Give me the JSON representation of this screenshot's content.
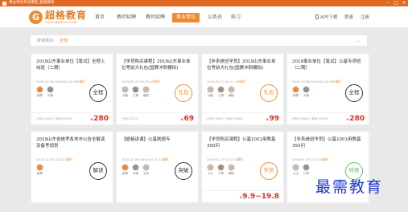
{
  "window": {
    "title": "事业单位考试课程_超格教育"
  },
  "logo": {
    "name": "超格教育",
    "sub": "CHAOGEJIAOYU.COM",
    "mark": "G"
  },
  "nav": {
    "items": [
      "首页",
      "教师招聘",
      "教师招聘",
      "事业单位",
      "公务员",
      "练习"
    ],
    "active_index": 3,
    "app_download": "APP下载",
    "login": "登录",
    "register": "注册"
  },
  "filter": {
    "label": "按课类别：",
    "value": "全部"
  },
  "cards": [
    {
      "title": "2019山东事业单位【笔试】全程上岗班（二期）",
      "meta": "2018.10.08-2019.02.24",
      "hours": "399课时",
      "teachers": [
        "超哥",
        "刘涛"
      ],
      "stamp": "全程",
      "stamp_style": "dark",
      "footer": "已购(24456) | 剩余(33500)",
      "price": "280"
    },
    {
      "title": "【学员购买课程】2019山东事业单位考前大礼包(国赛冲刺模拟)",
      "meta": "2019.02.27-03.12",
      "hours": "45课时",
      "teachers": [
        "问鼎",
        "江哥",
        "朝阳"
      ],
      "stamp": "礼包",
      "stamp_style": "orange",
      "footer": "已购(14125)",
      "price": "69"
    },
    {
      "title": "【非系统班学员】2019山东事业单位考前大礼包(国赛冲刺模拟)",
      "meta": "2019.02.27-03.11",
      "hours": "45课时",
      "teachers": [
        "问鼎",
        "江哥",
        "朝阳"
      ],
      "stamp": "礼包",
      "stamp_style": "orange",
      "footer": "已购(23846) | 剩余(33846)",
      "price": "99"
    },
    {
      "title": "2019事业单位【笔试】公基专项班（二期）",
      "meta": "2018.10.08-2019.02.24",
      "hours": "399课时",
      "teachers": [
        "超哥",
        "刘涛"
      ],
      "stamp": "全程",
      "stamp_style": "dark",
      "footer": "已购(24666) | 剩余(33596)",
      "price": "280"
    },
    {
      "title": "2019山东省统考各地市公告全解读及备考规划",
      "meta": "2019.12.28 12:28",
      "hours": "2课时",
      "teachers": [
        "超哥"
      ],
      "stamp": "解读",
      "stamp_style": "dark",
      "footer": "",
      "price": ""
    },
    {
      "title": "【超格讲课】公基刷题专",
      "meta": "2018.10.29-2019.03.11",
      "hours": "13课时",
      "teachers": [
        "超哥",
        "刘涛",
        "王老"
      ],
      "stamp": "突破",
      "stamp_style": "dark",
      "footer": "",
      "price": ""
    },
    {
      "title": "【学员购买课程】公基1001用教基350问",
      "meta": "2019.01.29 12:11",
      "hours": "8课时",
      "teachers": [
        "大大",
        "江哥",
        "朝阳"
      ],
      "stamp": "学员",
      "stamp_style": "orange",
      "footer": "",
      "price": "9.9~19.8"
    },
    {
      "title": "【非系统班学员】公基1001用教基350问",
      "meta": "2019.01.29 12:11",
      "hours": "8课时",
      "teachers": [
        "大大",
        "江哥"
      ],
      "stamp": "特惠",
      "stamp_style": "green",
      "footer": "",
      "price": ""
    }
  ],
  "price_label": "¥",
  "watermark": "最需教育"
}
